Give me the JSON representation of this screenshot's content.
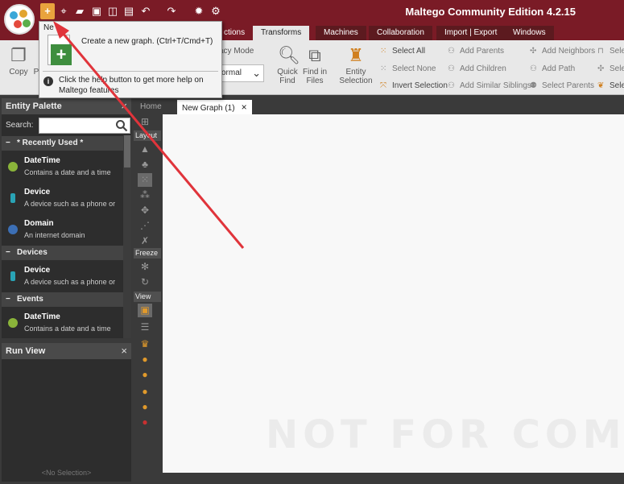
{
  "app": {
    "title": "Maltego Community Edition 4.2.15"
  },
  "quick_access": {
    "new_graph": "new-graph-icon",
    "icons": [
      "new-graph-icon",
      "target-icon",
      "open-folder-icon",
      "save-icon",
      "save-all-icon",
      "save-as-icon",
      "undo-icon",
      "redo-icon",
      "settings-icon",
      "gear-dropdown-icon"
    ]
  },
  "menu": {
    "items": [
      {
        "label": "ctions"
      },
      {
        "label": "Transforms"
      },
      {
        "label": "Machines"
      },
      {
        "label": "Collaboration"
      },
      {
        "label": "Import | Export"
      },
      {
        "label": "Windows"
      }
    ]
  },
  "ribbon": {
    "copy": "Copy",
    "paste_partial": "P",
    "privacy_mode": "acy Mode",
    "privacy_value": "ormal",
    "quick_find": [
      "Quick",
      "Find"
    ],
    "find_in_files": [
      "Find in",
      "Files"
    ],
    "entity_selection": [
      "Entity",
      "Selection"
    ],
    "select_all": "Select All",
    "select_none": "Select None",
    "invert_selection": "Invert Selection",
    "add_parents": "Add Parents",
    "add_children": "Add Children",
    "add_similar_siblings": "Add Similar Siblings",
    "add_neighbors": "Add Neighbors",
    "add_path": "Add Path",
    "select_parents": "Select Parents",
    "sel_trunc_1": "Sele",
    "sel_trunc_2": "Sele",
    "sel_trunc_3": "Sele"
  },
  "tooltip": {
    "title": "Ne",
    "description": "Create a new graph. (Ctrl+T/Cmd+T)",
    "help": "Click the help button to get more help on Maltego features"
  },
  "palette": {
    "title": "Entity Palette",
    "close": "×",
    "search_label": "Search:",
    "search_value": "",
    "groups": [
      {
        "label": "* Recently Used *",
        "toggle": "−"
      },
      {
        "label": "Devices",
        "toggle": "−"
      },
      {
        "label": "Events",
        "toggle": "−"
      }
    ],
    "entities": [
      {
        "name": "DateTime",
        "desc": "Contains a date and a time",
        "color": "#8ab43a"
      },
      {
        "name": "Device",
        "desc": "A device such as a phone or",
        "color": "#29a3b5"
      },
      {
        "name": "Domain",
        "desc": "An internet domain",
        "color": "#3c6fb5"
      },
      {
        "name": "Device",
        "desc": "A device such as a phone or",
        "color": "#29a3b5"
      },
      {
        "name": "DateTime",
        "desc": "Contains a date and a time",
        "color": "#8ab43a"
      }
    ]
  },
  "run_view": {
    "title": "Run View",
    "close": "×",
    "empty": "<No Selection>"
  },
  "graph_tabs": [
    {
      "label": "Home"
    },
    {
      "label": "New Graph (1)",
      "close": "×"
    }
  ],
  "left_toolbar": {
    "sections": [
      "Layout",
      "Freeze",
      "View"
    ]
  },
  "canvas": {
    "watermark": "NOT FOR COMMERCIAL"
  },
  "colors": {
    "title_bar": "#7a1b26",
    "accent": "#e19a2b",
    "annotation_arrow": "#e0343b"
  }
}
